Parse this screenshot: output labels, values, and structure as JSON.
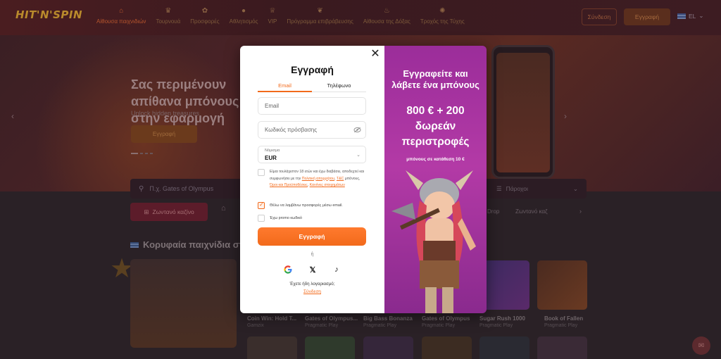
{
  "header": {
    "logo": "HIT'N'SPIN",
    "nav": [
      {
        "label": "Αίθουσα παιχνιδιών",
        "icon": "home-icon",
        "active": true
      },
      {
        "label": "Τουρνουά",
        "icon": "trophy-icon",
        "active": false
      },
      {
        "label": "Προσφορές",
        "icon": "gift-icon",
        "active": false
      },
      {
        "label": "Αθλητισμός",
        "icon": "ball-icon",
        "active": false
      },
      {
        "label": "VIP",
        "icon": "crown-icon",
        "active": false
      },
      {
        "label": "Πρόγραμμα επιβράβευσης",
        "icon": "leaf-icon",
        "active": false
      },
      {
        "label": "Αίθουσα της Δόξας",
        "icon": "flame-icon",
        "active": false
      },
      {
        "label": "Τροχός της Τύχης",
        "icon": "wheel-icon",
        "active": false
      }
    ],
    "login_label": "Σύνδεση",
    "register_label": "Εγγραφή",
    "language": "EL"
  },
  "hero": {
    "title": "Σας περιμένουν απίθανα μπόνους στην εφαρμογή",
    "subtitle": "Unlock hidden treasures",
    "button": "Εγγραφή"
  },
  "search": {
    "placeholder": "Π.χ. Gates of Olympus",
    "providers_label": "Πάροχοι"
  },
  "categories": {
    "live_casino": "Ζωντανό καζίνο",
    "right_1": "Drop",
    "right_2": "Ζωντανό καζ"
  },
  "section": {
    "title": "Κορυφαία παιχνίδια στ"
  },
  "games": [
    {
      "name": "Coin Win: Hold T...",
      "provider": "Gamzix"
    },
    {
      "name": "Gates of Olympus...",
      "provider": "Pragmatic Play"
    },
    {
      "name": "Big Bass Bonanza",
      "provider": "Pragmatic Play"
    },
    {
      "name": "Gates of Olympus",
      "provider": "Pragmatic Play"
    },
    {
      "name": "Sugar Rush 1000",
      "provider": "Pragmatic Play"
    },
    {
      "name": "Book of Fallen",
      "provider": "Pragmatic Play"
    }
  ],
  "modal": {
    "title": "Εγγραφή",
    "tabs": [
      "Email",
      "Τηλέφωνο"
    ],
    "email_placeholder": "Email",
    "password_placeholder": "Κωδικός πρόσβασης",
    "currency_label": "Νόμισμα",
    "currency_value": "EUR",
    "terms_text": "Είμαι τουλάχιστον 18 ετών και έχω διαβάσει, αποδεχτεί και συμφωνήσει με την ",
    "terms_link_1": "Πολιτική απορρήτου",
    "terms_sep_1": ", ",
    "terms_link_2": "T&C",
    "terms_mid": " μπόνους, ",
    "terms_link_3": "Όροι και Προϋποθέσεις",
    "terms_sep_2": ", ",
    "terms_link_4": "Κανόνες στοιχημάτων",
    "offers_label": "Θέλω να λαμβάνω προσφορές μέσω email.",
    "offers_checked": true,
    "promo_label": "Έχω promo κωδικό",
    "submit_label": "Εγγραφή",
    "or_label": "ή",
    "have_account": "Έχετε ήδη λογαριασμό;",
    "login_link": "Σύνδεση",
    "social": [
      "google-icon",
      "x-icon",
      "tiktok-icon"
    ]
  },
  "promo": {
    "line1": "Εγγραφείτε και λάβετε ένα μπόνους",
    "line2": "800 € + 200 δωρεάν περιστροφές",
    "line3": "μπόνους σε κατάθεση 10 €"
  },
  "colors": {
    "accent": "#f26a1b",
    "promo_bg": "#a535a0"
  }
}
